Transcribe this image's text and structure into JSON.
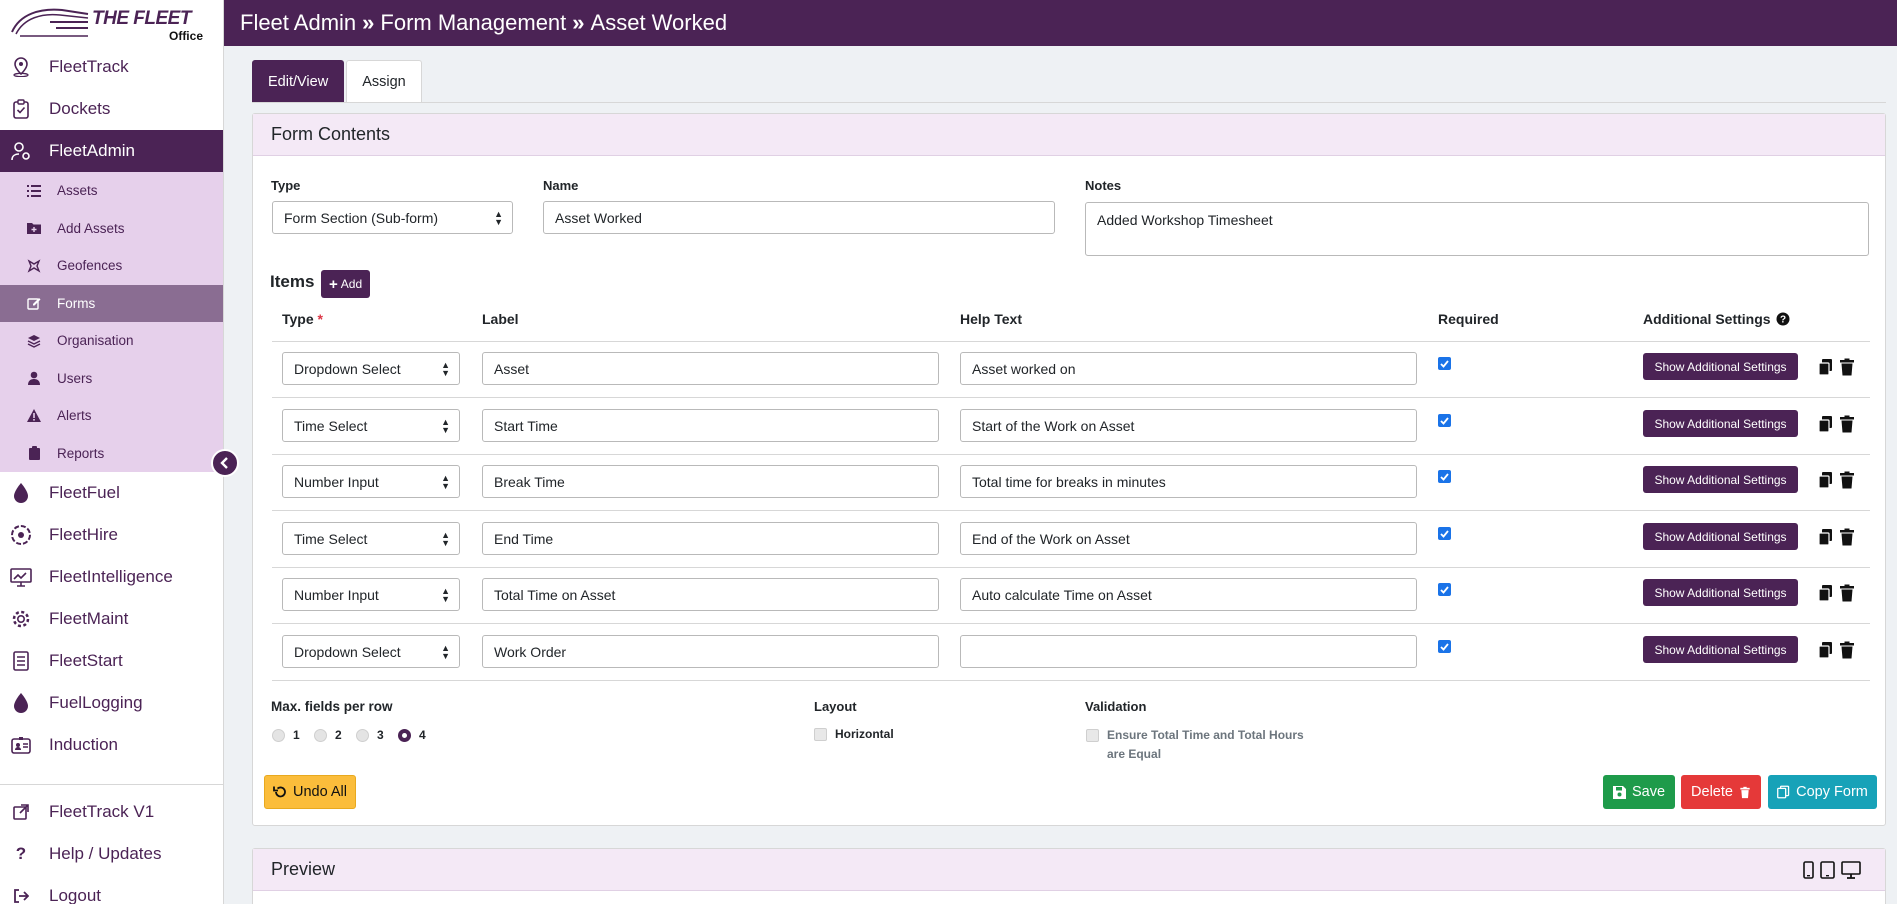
{
  "app": {
    "brand": "THE FLEET",
    "brand_sub": "Office"
  },
  "header": {
    "crumb1": "Fleet Admin",
    "crumb2": "Form Management",
    "crumb3": "Asset Worked",
    "separator": "»"
  },
  "sidebar": {
    "top_items": [
      {
        "label": "FleetTrack",
        "icon": "map-pin-icon"
      },
      {
        "label": "Dockets",
        "icon": "clipboard-check-icon"
      },
      {
        "label": "FleetAdmin",
        "icon": "user-gear-icon"
      }
    ],
    "sub_items": [
      {
        "label": "Assets",
        "icon": "list-icon"
      },
      {
        "label": "Add Assets",
        "icon": "folder-plus-icon"
      },
      {
        "label": "Geofences",
        "icon": "geofence-icon"
      },
      {
        "label": "Forms",
        "icon": "edit-icon"
      },
      {
        "label": "Organisation",
        "icon": "layers-icon"
      },
      {
        "label": "Users",
        "icon": "user-icon"
      },
      {
        "label": "Alerts",
        "icon": "warning-icon"
      },
      {
        "label": "Reports",
        "icon": "clipboard-icon"
      }
    ],
    "mid_items": [
      {
        "label": "FleetFuel",
        "icon": "drop-icon"
      },
      {
        "label": "FleetHire",
        "icon": "hire-icon"
      },
      {
        "label": "FleetIntelligence",
        "icon": "monitor-chart-icon"
      },
      {
        "label": "FleetMaint",
        "icon": "gear-icon"
      },
      {
        "label": "FleetStart",
        "icon": "checklist-icon"
      },
      {
        "label": "FuelLogging",
        "icon": "drop-icon"
      },
      {
        "label": "Induction",
        "icon": "id-card-icon"
      }
    ],
    "bottom_items": [
      {
        "label": "FleetTrack V1",
        "icon": "external-link-icon"
      },
      {
        "label": "Help / Updates",
        "icon": "question-icon"
      },
      {
        "label": "Logout",
        "icon": "logout-icon"
      }
    ]
  },
  "tabs": [
    {
      "label": "Edit/View"
    },
    {
      "label": "Assign"
    }
  ],
  "form_card": {
    "title": "Form Contents",
    "type_label": "Type",
    "type_value": "Form Section (Sub-form)",
    "name_label": "Name",
    "name_value": "Asset Worked",
    "notes_label": "Notes",
    "notes_value": "Added Workshop Timesheet",
    "items_title": "Items",
    "add_label": "Add",
    "columns": {
      "type": "Type",
      "required_mark": "*",
      "label": "Label",
      "help": "Help Text",
      "required": "Required",
      "additional": "Additional Settings"
    },
    "rows": [
      {
        "type": "Dropdown Select",
        "label": "Asset",
        "help": "Asset worked on",
        "required": true
      },
      {
        "type": "Time Select",
        "label": "Start Time",
        "help": "Start of the Work on Asset",
        "required": true
      },
      {
        "type": "Number Input",
        "label": "Break Time",
        "help": "Total time for breaks in minutes",
        "required": true
      },
      {
        "type": "Time Select",
        "label": "End Time",
        "help": "End of the Work on Asset",
        "required": true
      },
      {
        "type": "Number Input",
        "label": "Total Time on Asset",
        "help": "Auto calculate Time on Asset",
        "required": true
      },
      {
        "type": "Dropdown Select",
        "label": "Work Order",
        "help": "",
        "required": true
      }
    ],
    "settings_btn_label": "Show Additional Settings",
    "max_fields_label": "Max. fields per row",
    "max_fields_options": [
      "1",
      "2",
      "3",
      "4"
    ],
    "max_fields_selected": "4",
    "layout_label": "Layout",
    "layout_option": "Horizontal",
    "validation_label": "Validation",
    "validation_option_line1": "Ensure Total Time and Total Hours",
    "validation_option_line2": "are Equal",
    "undo_label": "Undo All",
    "save_label": "Save",
    "delete_label": "Delete",
    "copy_label": "Copy Form"
  },
  "preview": {
    "title": "Preview"
  },
  "colors": {
    "brand": "#4b2355",
    "save": "#1e9b4a",
    "delete": "#e53939",
    "copy": "#17a2b8",
    "undo": "#fbbd3b"
  }
}
